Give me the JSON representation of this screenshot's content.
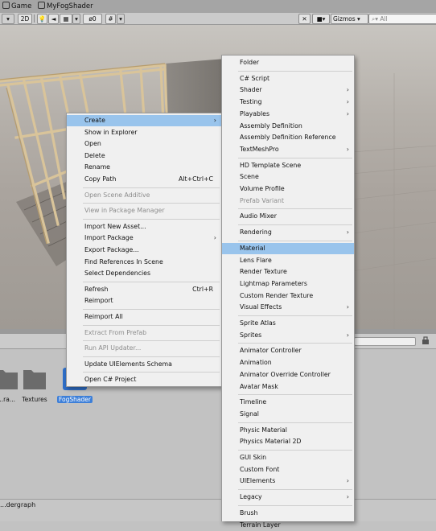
{
  "tabs": [
    {
      "label": "Game",
      "icon": "game-tab-icon"
    },
    {
      "label": "MyFogShader",
      "icon": "shader-tab-icon"
    }
  ],
  "toolbar": {
    "mode_2d": "2D",
    "hidden_count": "0",
    "gizmos_label": "Gizmos",
    "search_placeholder": "All"
  },
  "project": {
    "assets": [
      {
        "label": "...ra..."
      },
      {
        "label": "Textures"
      },
      {
        "label": "FogShader",
        "selected": true
      }
    ],
    "status_text": "...dergraph"
  },
  "context_menu": [
    {
      "label": "Create",
      "submenu": true,
      "highlighted": true
    },
    {
      "label": "Show in Explorer"
    },
    {
      "label": "Open"
    },
    {
      "label": "Delete"
    },
    {
      "label": "Rename"
    },
    {
      "label": "Copy Path",
      "shortcut": "Alt+Ctrl+C"
    },
    {
      "separator": true
    },
    {
      "label": "Open Scene Additive",
      "disabled": true
    },
    {
      "separator": true
    },
    {
      "label": "View in Package Manager",
      "disabled": true
    },
    {
      "separator": true
    },
    {
      "label": "Import New Asset..."
    },
    {
      "label": "Import Package",
      "submenu": true
    },
    {
      "label": "Export Package..."
    },
    {
      "label": "Find References In Scene"
    },
    {
      "label": "Select Dependencies"
    },
    {
      "separator": true
    },
    {
      "label": "Refresh",
      "shortcut": "Ctrl+R"
    },
    {
      "label": "Reimport"
    },
    {
      "separator": true
    },
    {
      "label": "Reimport All"
    },
    {
      "separator": true
    },
    {
      "label": "Extract From Prefab",
      "disabled": true
    },
    {
      "separator": true
    },
    {
      "label": "Run API Updater...",
      "disabled": true
    },
    {
      "separator": true
    },
    {
      "label": "Update UIElements Schema"
    },
    {
      "separator": true
    },
    {
      "label": "Open C# Project"
    }
  ],
  "create_submenu": [
    {
      "label": "Folder"
    },
    {
      "separator": true
    },
    {
      "label": "C# Script"
    },
    {
      "label": "Shader",
      "submenu": true
    },
    {
      "label": "Testing",
      "submenu": true
    },
    {
      "label": "Playables",
      "submenu": true
    },
    {
      "label": "Assembly Definition"
    },
    {
      "label": "Assembly Definition Reference"
    },
    {
      "label": "TextMeshPro",
      "submenu": true
    },
    {
      "separator": true
    },
    {
      "label": "HD Template Scene"
    },
    {
      "label": "Scene"
    },
    {
      "label": "Volume Profile"
    },
    {
      "label": "Prefab Variant",
      "disabled": true
    },
    {
      "separator": true
    },
    {
      "label": "Audio Mixer"
    },
    {
      "separator": true
    },
    {
      "label": "Rendering",
      "submenu": true
    },
    {
      "separator": true
    },
    {
      "label": "Material",
      "highlighted": true
    },
    {
      "label": "Lens Flare"
    },
    {
      "label": "Render Texture"
    },
    {
      "label": "Lightmap Parameters"
    },
    {
      "label": "Custom Render Texture"
    },
    {
      "label": "Visual Effects",
      "submenu": true
    },
    {
      "separator": true
    },
    {
      "label": "Sprite Atlas"
    },
    {
      "label": "Sprites",
      "submenu": true
    },
    {
      "separator": true
    },
    {
      "label": "Animator Controller"
    },
    {
      "label": "Animation"
    },
    {
      "label": "Animator Override Controller"
    },
    {
      "label": "Avatar Mask"
    },
    {
      "separator": true
    },
    {
      "label": "Timeline"
    },
    {
      "label": "Signal"
    },
    {
      "separator": true
    },
    {
      "label": "Physic Material"
    },
    {
      "label": "Physics Material 2D"
    },
    {
      "separator": true
    },
    {
      "label": "GUI Skin"
    },
    {
      "label": "Custom Font"
    },
    {
      "label": "UIElements",
      "submenu": true
    },
    {
      "separator": true
    },
    {
      "label": "Legacy",
      "submenu": true
    },
    {
      "separator": true
    },
    {
      "label": "Brush"
    },
    {
      "label": "Terrain Layer"
    }
  ]
}
